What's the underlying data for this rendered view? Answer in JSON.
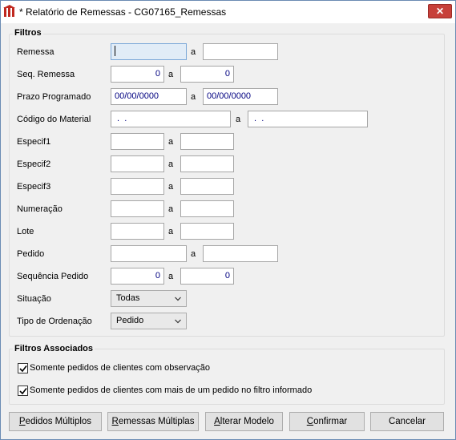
{
  "window": {
    "title": "* Relatório de Remessas - CG07165_Remessas",
    "close_symbol": "✕",
    "icon": "report-app-icon"
  },
  "filtros": {
    "title": "Filtros",
    "separator": "a",
    "rows": {
      "remessa": {
        "label": "Remessa",
        "from": "",
        "to": ""
      },
      "seq_remessa": {
        "label": "Seq. Remessa",
        "from": "0",
        "to": "0"
      },
      "prazo_programado": {
        "label": "Prazo Programado",
        "from": "00/00/0000",
        "to": "00/00/0000"
      },
      "codigo_material": {
        "label": "Código do Material",
        "from": " .  .",
        "to": " .  ."
      },
      "especif1": {
        "label": "Especif1",
        "from": "",
        "to": ""
      },
      "especif2": {
        "label": "Especif2",
        "from": "",
        "to": ""
      },
      "especif3": {
        "label": "Especif3",
        "from": "",
        "to": ""
      },
      "numeracao": {
        "label": "Numeração",
        "from": "",
        "to": ""
      },
      "lote": {
        "label": "Lote",
        "from": "",
        "to": ""
      },
      "pedido": {
        "label": "Pedido",
        "from": "",
        "to": ""
      },
      "sequencia_pedido": {
        "label": "Sequência Pedido",
        "from": "0",
        "to": "0"
      }
    },
    "situacao": {
      "label": "Situação",
      "value": "Todas"
    },
    "tipo_ordenacao": {
      "label": "Tipo de Ordenação",
      "value": "Pedido"
    }
  },
  "filtros_associados": {
    "title": "Filtros Associados",
    "obs": {
      "label": "Somente pedidos de clientes com observação",
      "checked": true
    },
    "multi": {
      "label": "Somente pedidos de clientes com mais de um pedido no filtro informado",
      "checked": true
    }
  },
  "buttons": {
    "pedidos_multiplos": {
      "mn": "P",
      "rest": "edidos Múltiplos"
    },
    "remessas_multiplas": {
      "mn": "R",
      "rest": "emessas Múltiplas"
    },
    "alterar_modelo": {
      "mn": "A",
      "rest": "lterar Modelo"
    },
    "confirmar": {
      "mn": "C",
      "rest": "onfirmar"
    },
    "cancelar": {
      "mn": "",
      "rest": "Cancelar"
    }
  }
}
